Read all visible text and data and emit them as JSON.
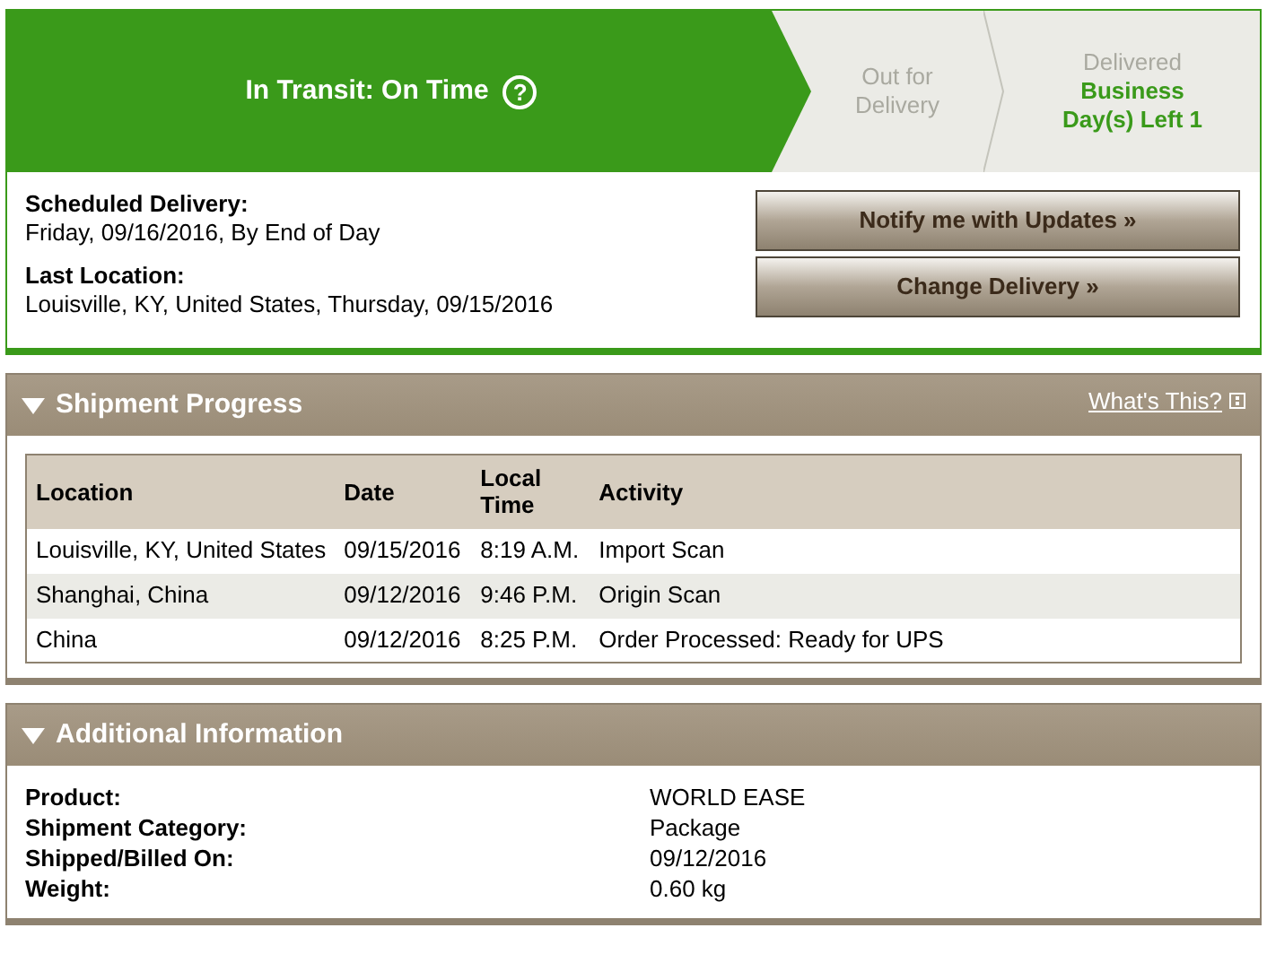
{
  "status_steps": [
    {
      "label": "In Transit: On Time",
      "selected": true,
      "help": "?"
    },
    {
      "label": "Out for Delivery",
      "selected": false
    },
    {
      "label": "Delivered",
      "note": "Business Day(s) Left 1",
      "selected": false
    }
  ],
  "summary": [
    {
      "label": "Scheduled Delivery:",
      "value": "Friday, 09/16/2016, By End of Day"
    },
    {
      "label": "Last Location:",
      "value": "Louisville, KY, United States, Thursday, 09/15/2016"
    }
  ],
  "buttons": [
    "Notify me with Updates »",
    "Change Delivery »"
  ],
  "shipment_progress": {
    "title": "Shipment Progress",
    "expanded": true,
    "link": "What's This?",
    "columns": [
      "Location",
      "Date",
      "Local Time",
      "Activity"
    ],
    "rows": [
      [
        "Louisville, KY, United States",
        "09/15/2016",
        "8:19 A.M.",
        "Import Scan"
      ],
      [
        "Shanghai, China",
        "09/12/2016",
        "9:46 P.M.",
        "Origin Scan"
      ],
      [
        "China",
        "09/12/2016",
        "8:25 P.M.",
        "Order Processed: Ready for UPS"
      ]
    ]
  },
  "additional_information": {
    "title": "Additional Information",
    "expanded": true,
    "fields": [
      {
        "label": "Product:",
        "value": "WORLD EASE"
      },
      {
        "label": "Shipment Category:",
        "value": "Package"
      },
      {
        "label": "Shipped/Billed On:",
        "value": "09/12/2016"
      },
      {
        "label": "Weight:",
        "value": "0.60 kg"
      }
    ]
  }
}
